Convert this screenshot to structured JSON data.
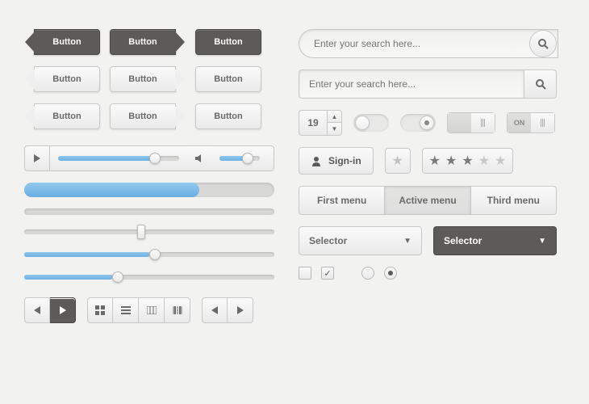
{
  "buttons": {
    "row1": [
      "Button",
      "Button",
      "Button"
    ],
    "row2": [
      "Button",
      "Button",
      "Button"
    ],
    "row3": [
      "Button",
      "Button",
      "Button"
    ]
  },
  "media": {
    "seek_pct": 80,
    "volume_pct": 70
  },
  "progress": {
    "bar1_pct": 70,
    "bar2_pct": 0
  },
  "sliders": {
    "s1_pct": 45,
    "s2_pct": 50,
    "s3_pct": 35
  },
  "search": {
    "placeholder1": "Enter your search here...",
    "placeholder2": "Enter your search here..."
  },
  "stepper": {
    "value": "19"
  },
  "toggles": {
    "t1_on": false,
    "t2_on": true,
    "sq1_label": "",
    "sq2_label_on": "ON"
  },
  "signin": {
    "label": "Sign-in"
  },
  "rating": {
    "value": 3,
    "max": 5
  },
  "tabs": {
    "items": [
      "First menu",
      "Active menu",
      "Third menu"
    ],
    "active_index": 1
  },
  "selectors": {
    "light": "Selector",
    "dark": "Selector"
  },
  "controls": {
    "checkbox_unchecked": false,
    "checkbox_checked": true,
    "radio_unchecked": false,
    "radio_checked": true
  }
}
